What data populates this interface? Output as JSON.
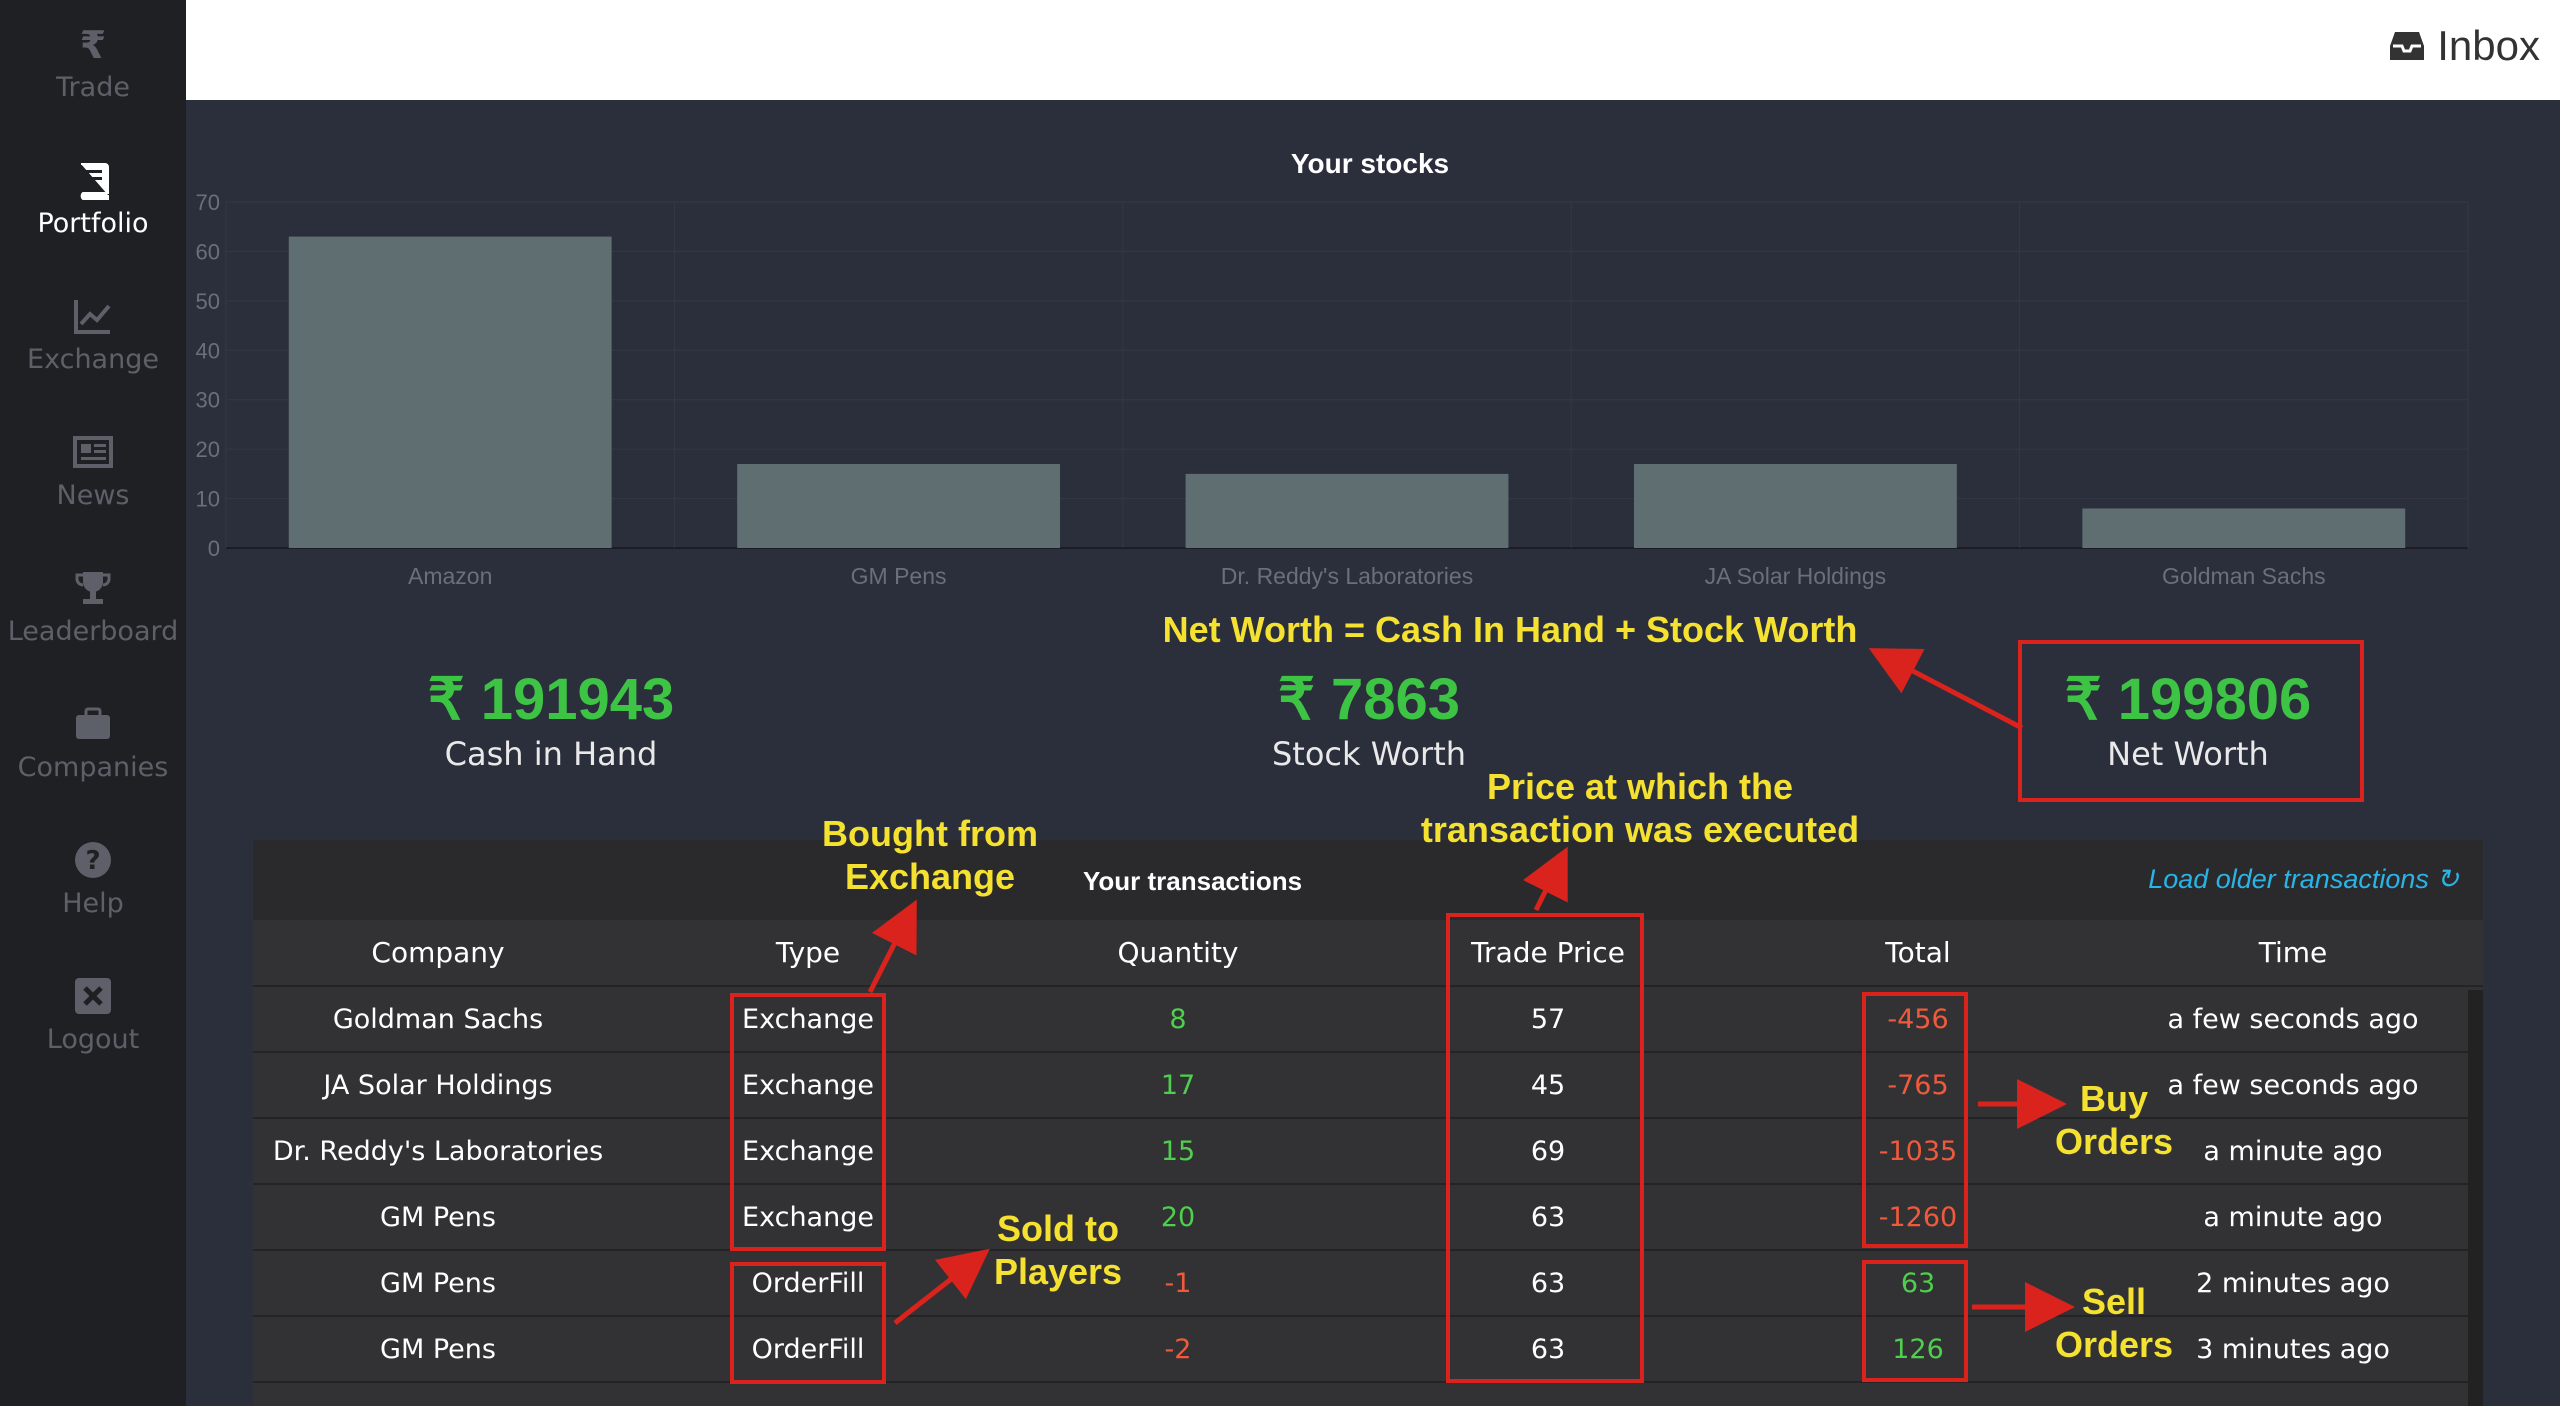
{
  "sidebar": {
    "items": [
      {
        "label": "Trade",
        "icon": "rupee-icon",
        "active": false
      },
      {
        "label": "Portfolio",
        "icon": "book-icon",
        "active": true
      },
      {
        "label": "Exchange",
        "icon": "line-chart-icon",
        "active": false
      },
      {
        "label": "News",
        "icon": "newspaper-icon",
        "active": false
      },
      {
        "label": "Leaderboard",
        "icon": "trophy-icon",
        "active": false
      },
      {
        "label": "Companies",
        "icon": "briefcase-icon",
        "active": false
      },
      {
        "label": "Help",
        "icon": "question-icon",
        "active": false
      },
      {
        "label": "Logout",
        "icon": "close-icon",
        "active": false
      }
    ]
  },
  "topbar": {
    "inbox_label": "Inbox"
  },
  "chart_data": {
    "type": "bar",
    "title": "Your stocks",
    "categories": [
      "Amazon",
      "GM Pens",
      "Dr. Reddy's Laboratories",
      "JA Solar Holdings",
      "Goldman Sachs"
    ],
    "values": [
      63,
      17,
      15,
      17,
      8
    ],
    "ylim": [
      0,
      70
    ],
    "yticks": [
      0,
      10,
      20,
      30,
      40,
      50,
      60,
      70
    ],
    "grid": true,
    "bar_color": "#5f6e70"
  },
  "stats": {
    "cash": {
      "value": "₹ 191943",
      "label": "Cash in Hand"
    },
    "stock": {
      "value": "₹ 7863",
      "label": "Stock Worth"
    },
    "net": {
      "value": "₹ 199806",
      "label": "Net Worth"
    }
  },
  "transactions": {
    "title": "Your transactions",
    "load_older": "Load older transactions ↻",
    "columns": [
      "Company",
      "Type",
      "Quantity",
      "Trade Price",
      "Total",
      "Time"
    ],
    "rows": [
      {
        "company": "Goldman Sachs",
        "type": "Exchange",
        "quantity": "8",
        "price": "57",
        "total": "-456",
        "time": "a few seconds ago"
      },
      {
        "company": "JA Solar Holdings",
        "type": "Exchange",
        "quantity": "17",
        "price": "45",
        "total": "-765",
        "time": "a few seconds ago"
      },
      {
        "company": "Dr. Reddy's Laboratories",
        "type": "Exchange",
        "quantity": "15",
        "price": "69",
        "total": "-1035",
        "time": "a minute ago"
      },
      {
        "company": "GM Pens",
        "type": "Exchange",
        "quantity": "20",
        "price": "63",
        "total": "-1260",
        "time": "a minute ago"
      },
      {
        "company": "GM Pens",
        "type": "OrderFill",
        "quantity": "-1",
        "price": "63",
        "total": "63",
        "time": "2 minutes ago"
      },
      {
        "company": "GM Pens",
        "type": "OrderFill",
        "quantity": "-2",
        "price": "63",
        "total": "126",
        "time": "3 minutes ago"
      }
    ]
  },
  "annotations": {
    "net_worth_formula": "Net Worth = Cash In Hand + Stock Worth",
    "price_executed_1": "Price at which the",
    "price_executed_2": "transaction was executed",
    "bought_1": "Bought from",
    "bought_2": "Exchange",
    "sold_1": "Sold to",
    "sold_2": "Players",
    "buy_1": "Buy",
    "buy_2": "Orders",
    "sell_1": "Sell",
    "sell_2": "Orders"
  },
  "colors": {
    "accent_green": "#3ec445",
    "negative": "#f05a3c",
    "annotation": "#f5e130",
    "annotation_box": "#d9231c",
    "link": "#2ab4e6"
  }
}
